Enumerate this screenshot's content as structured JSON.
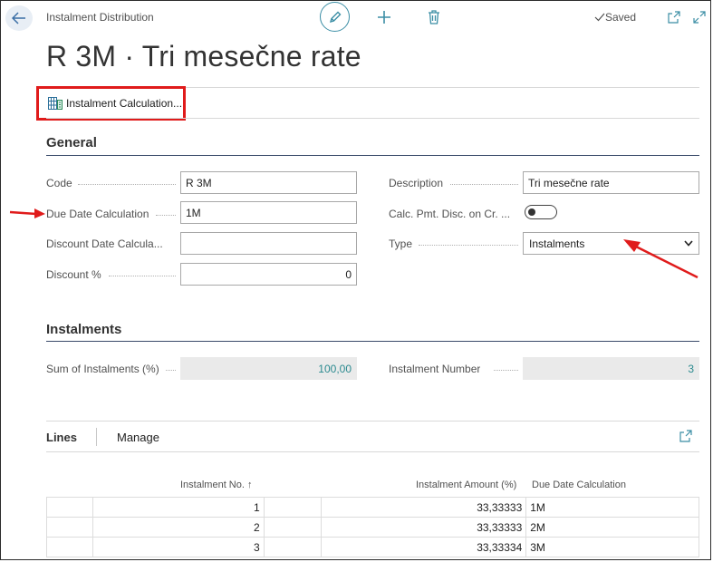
{
  "header": {
    "caption": "Instalment Distribution",
    "saved_label": "Saved",
    "title": "R 3M · Tri mesečne rate"
  },
  "actions": {
    "instalment_calculation": "Instalment Calculation..."
  },
  "general": {
    "section_title": "General",
    "code_label": "Code",
    "code_value": "R 3M",
    "due_date_calc_label": "Due Date Calculation",
    "due_date_calc_value": "1M",
    "discount_date_calc_label": "Discount Date Calcula...",
    "discount_date_calc_value": "",
    "discount_pct_label": "Discount %",
    "discount_pct_value": "0",
    "description_label": "Description",
    "description_value": "Tri mesečne rate",
    "calc_pmt_disc_label": "Calc. Pmt. Disc. on Cr. ...",
    "calc_pmt_disc_on": false,
    "type_label": "Type",
    "type_value": "Instalments"
  },
  "instalments": {
    "section_title": "Instalments",
    "sum_label": "Sum of Instalments (%)",
    "sum_value": "100,00",
    "number_label": "Instalment Number",
    "number_value": "3"
  },
  "lines": {
    "tab_lines": "Lines",
    "tab_manage": "Manage",
    "columns": {
      "instalment_no": "Instalment No. ↑",
      "instalment_amount": "Instalment Amount (%)",
      "due_date_calc": "Due Date Calculation"
    },
    "rows": [
      {
        "no": "1",
        "amount": "33,33333",
        "due": "1M"
      },
      {
        "no": "2",
        "amount": "33,33333",
        "due": "2M"
      },
      {
        "no": "3",
        "amount": "33,33334",
        "due": "3M"
      }
    ]
  },
  "colors": {
    "accent": "#3b8ea5",
    "highlight_red": "#e01b1b",
    "readonly_value": "#2b8a8f"
  }
}
